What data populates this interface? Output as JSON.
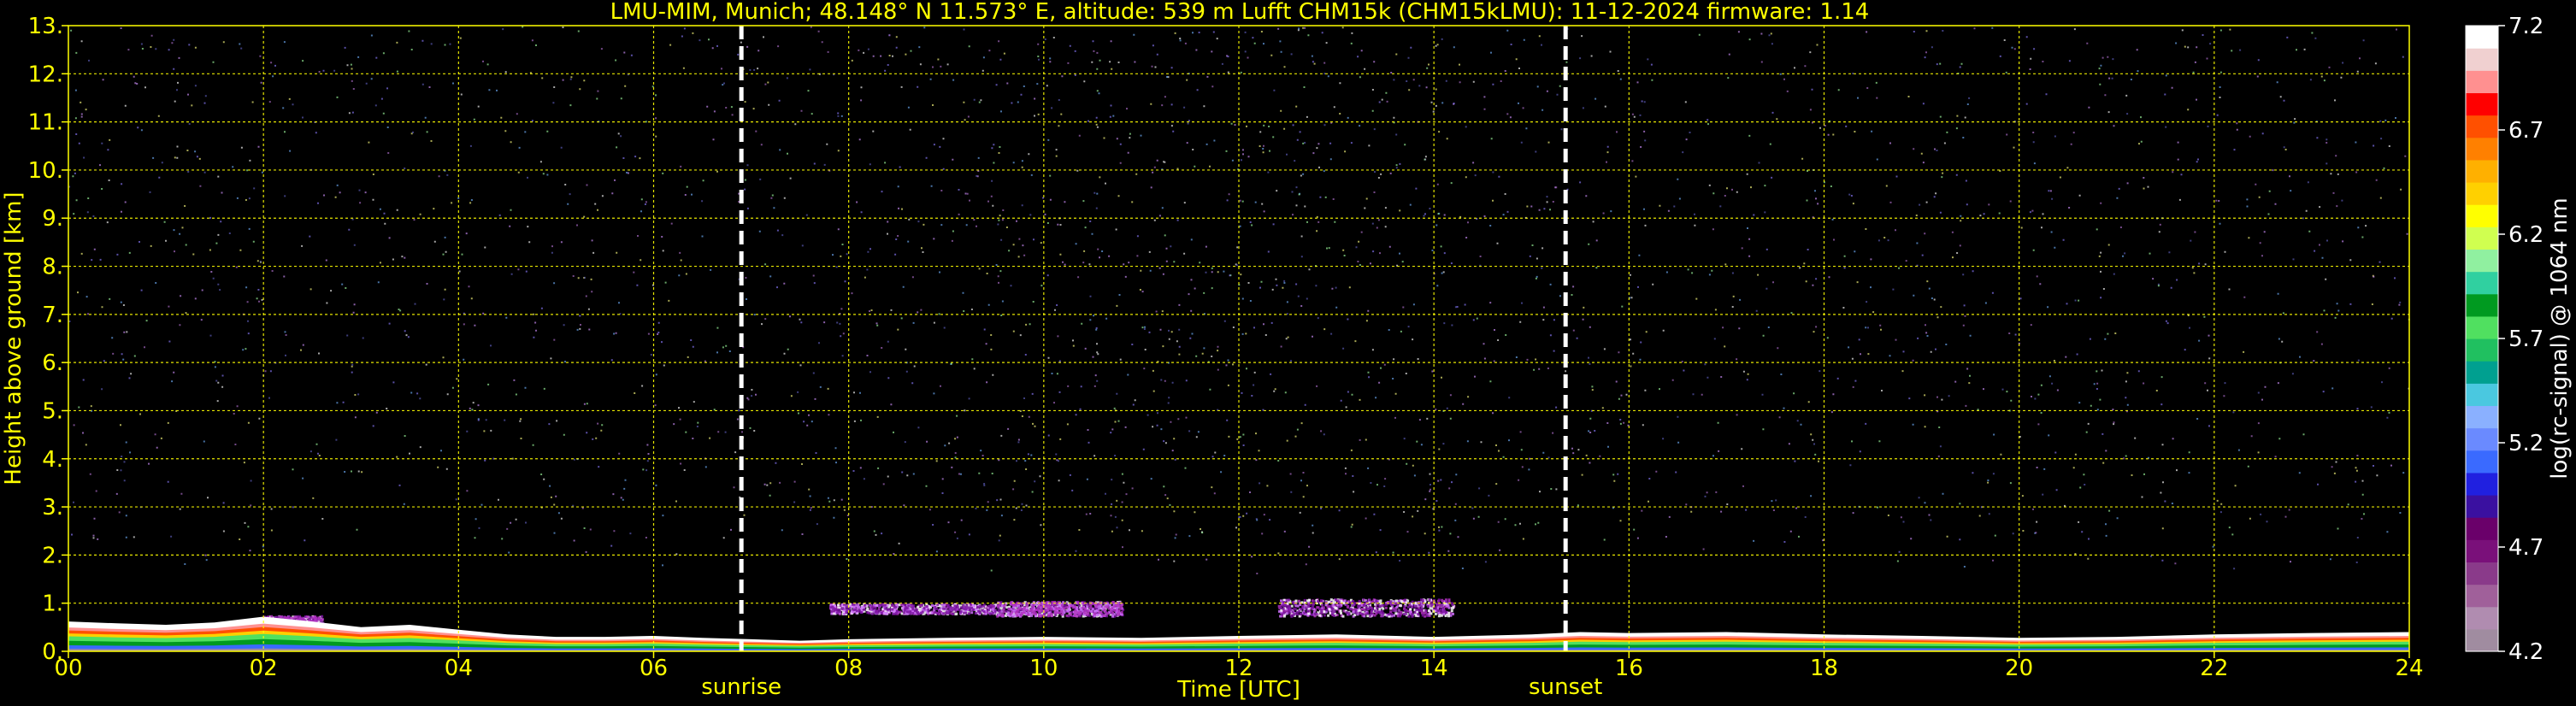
{
  "chart_data": {
    "type": "heatmap",
    "title": "LMU-MIM, Munich; 48.148° N 11.573° E, altitude: 539 m    Lufft CHM15k (CHM15kLMU): 11-12-2024    firmware: 1.14",
    "xlabel": "Time [UTC]",
    "ylabel": "Height above ground [km]",
    "xlim": [
      0,
      24
    ],
    "ylim": [
      0,
      13
    ],
    "x_ticks": [
      "00",
      "02",
      "04",
      "06",
      "08",
      "10",
      "12",
      "14",
      "16",
      "18",
      "20",
      "22",
      "24"
    ],
    "y_ticks": [
      "0.",
      "1.",
      "2.",
      "3.",
      "4.",
      "5.",
      "6.",
      "7.",
      "8.",
      "9.",
      "10.",
      "11.",
      "12.",
      "13."
    ],
    "grid": true,
    "events": [
      {
        "label": "sunrise",
        "time": 6.9
      },
      {
        "label": "sunset",
        "time": 15.35
      }
    ],
    "colorbar": {
      "label": "log(rc-signal) @ 1064 nm",
      "range": [
        4.2,
        7.2
      ],
      "ticks": [
        "4.2",
        "4.7",
        "5.2",
        "5.7",
        "6.2",
        "6.7",
        "7.2"
      ],
      "colors": [
        "#a08ca0",
        "#b08cb0",
        "#a0609a",
        "#8a3a8a",
        "#7a107a",
        "#6a006a",
        "#3a10a0",
        "#2020e0",
        "#3a6aff",
        "#6a8aff",
        "#8ab0ff",
        "#4ac8e0",
        "#00a090",
        "#20c060",
        "#50e060",
        "#009a20",
        "#30d0a0",
        "#90f0a0",
        "#d0ff50",
        "#ffff00",
        "#ffd000",
        "#ffb000",
        "#ff8000",
        "#ff5000",
        "#ff0000",
        "#ff9090",
        "#f0d0d0",
        "#ffffff"
      ]
    },
    "noise_colors": [
      "#8a7aff",
      "#b070d0",
      "#70b0ff",
      "#ffffff",
      "#d090ff",
      "#6060c0",
      "#a0ffa0",
      "#ffff80"
    ],
    "cloud_colors": [
      "#b030c0",
      "#7a10a0",
      "#d070ff",
      "#ffffff"
    ],
    "boundary_layer": [
      {
        "t": 0.0,
        "h": 0.62
      },
      {
        "t": 0.5,
        "h": 0.58
      },
      {
        "t": 1.0,
        "h": 0.55
      },
      {
        "t": 1.5,
        "h": 0.6
      },
      {
        "t": 2.0,
        "h": 0.72
      },
      {
        "t": 2.5,
        "h": 0.62
      },
      {
        "t": 3.0,
        "h": 0.5
      },
      {
        "t": 3.5,
        "h": 0.55
      },
      {
        "t": 4.0,
        "h": 0.45
      },
      {
        "t": 4.5,
        "h": 0.35
      },
      {
        "t": 5.0,
        "h": 0.3
      },
      {
        "t": 5.5,
        "h": 0.3
      },
      {
        "t": 6.0,
        "h": 0.32
      },
      {
        "t": 6.5,
        "h": 0.28
      },
      {
        "t": 7.0,
        "h": 0.25
      },
      {
        "t": 7.5,
        "h": 0.22
      },
      {
        "t": 8.0,
        "h": 0.25
      },
      {
        "t": 9.0,
        "h": 0.28
      },
      {
        "t": 10.0,
        "h": 0.3
      },
      {
        "t": 11.0,
        "h": 0.28
      },
      {
        "t": 12.0,
        "h": 0.32
      },
      {
        "t": 13.0,
        "h": 0.35
      },
      {
        "t": 14.0,
        "h": 0.3
      },
      {
        "t": 15.0,
        "h": 0.35
      },
      {
        "t": 15.5,
        "h": 0.4
      },
      {
        "t": 16.0,
        "h": 0.38
      },
      {
        "t": 17.0,
        "h": 0.4
      },
      {
        "t": 18.0,
        "h": 0.35
      },
      {
        "t": 19.0,
        "h": 0.32
      },
      {
        "t": 20.0,
        "h": 0.28
      },
      {
        "t": 21.0,
        "h": 0.3
      },
      {
        "t": 22.0,
        "h": 0.35
      },
      {
        "t": 23.0,
        "h": 0.38
      },
      {
        "t": 24.0,
        "h": 0.4
      }
    ],
    "cloud_layers": [
      {
        "t0": 7.8,
        "t1": 9.5,
        "h0": 0.8,
        "h1": 1.0
      },
      {
        "t0": 9.5,
        "t1": 10.8,
        "h0": 0.75,
        "h1": 1.05
      },
      {
        "t0": 12.4,
        "t1": 14.2,
        "h0": 0.75,
        "h1": 1.1
      },
      {
        "t0": 2.0,
        "t1": 2.6,
        "h0": 0.3,
        "h1": 0.75
      }
    ]
  }
}
